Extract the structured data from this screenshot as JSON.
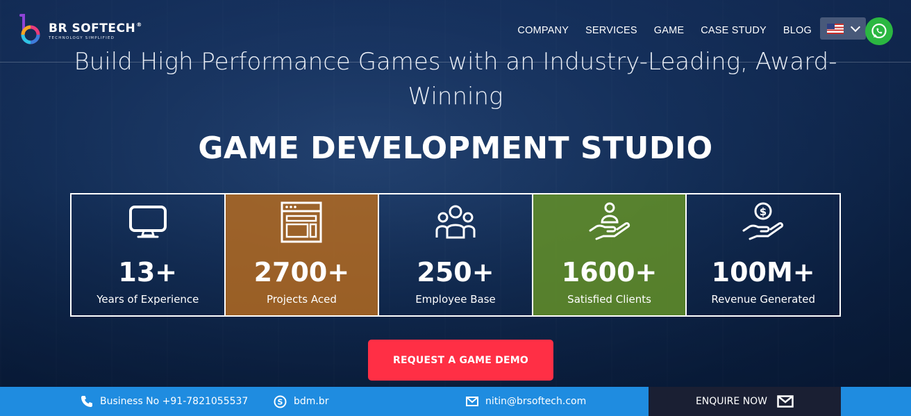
{
  "brand": {
    "name": "BR SOFTECH",
    "tagline": "TECHNOLOGY SIMPLIFIED",
    "reg": "®"
  },
  "nav": [
    {
      "label": "COMPANY"
    },
    {
      "label": "SERVICES"
    },
    {
      "label": "GAME"
    },
    {
      "label": "CASE STUDY"
    },
    {
      "label": "BLOG"
    }
  ],
  "hero": {
    "subtitle": "Build High Performance Games with an Industry-Leading, Award-Winning",
    "title": "GAME DEVELOPMENT STUDIO"
  },
  "stats": [
    {
      "value": "13+",
      "label": "Years of Experience",
      "icon": "monitor-icon"
    },
    {
      "value": "2700+",
      "label": "Projects Aced",
      "icon": "browser-layout-icon"
    },
    {
      "value": "250+",
      "label": "Employee Base",
      "icon": "team-icon"
    },
    {
      "value": "1600+",
      "label": "Satisfied Clients",
      "icon": "client-hand-icon"
    },
    {
      "value": "100M+",
      "label": "Revenue Generated",
      "icon": "revenue-hand-icon"
    }
  ],
  "cta": {
    "label": "REQUEST A GAME DEMO"
  },
  "contact": {
    "phone": "Business No +91-7821055537",
    "skype": "bdm.br",
    "email": "nitin@brsoftech.com",
    "enquire": "ENQUIRE NOW"
  },
  "colors": {
    "cta": "#ff2f45",
    "bottom_bar": "#1f8ce0",
    "enquire_bg": "#1a1f33",
    "orange_tile": "#ba6c1e",
    "green_tile": "#649128",
    "whatsapp": "#2bb741"
  }
}
